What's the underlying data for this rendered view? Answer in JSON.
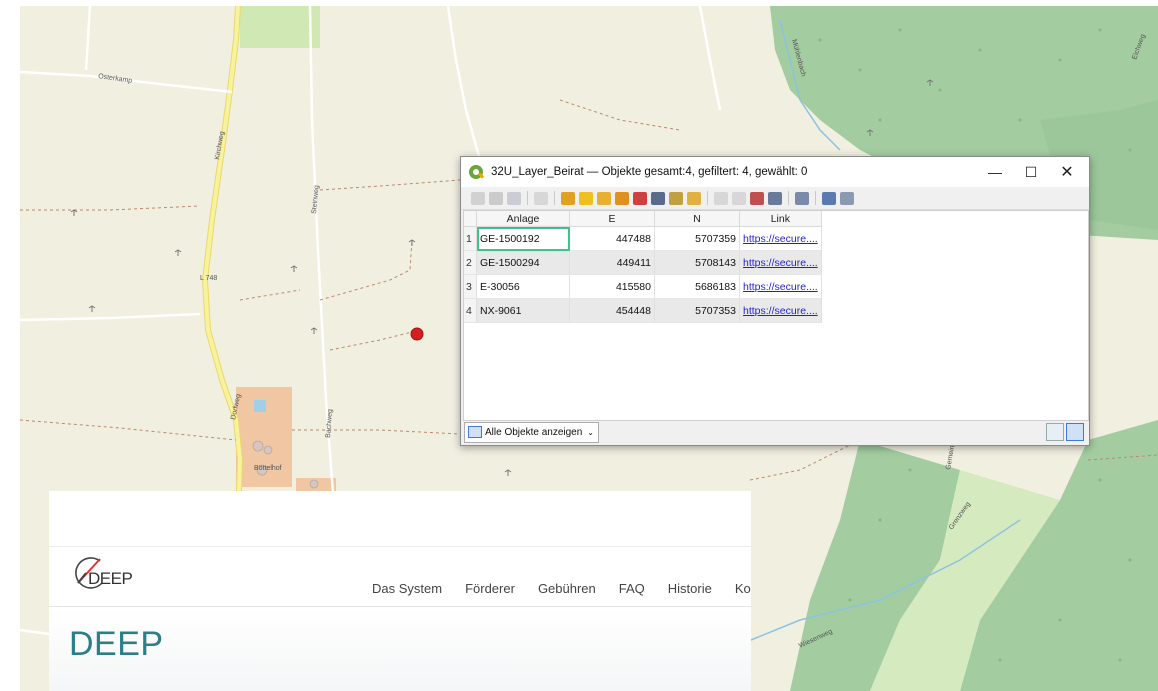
{
  "map": {
    "labels": {
      "road_l748": "L 748",
      "hof": "Böttelhof",
      "road_a": "Osterkamp",
      "road_b": "Kirchweg",
      "road_c": "Steinweg",
      "road_d": "Dorfweg",
      "road_e": "Bachweg",
      "road_f": "Eichweg",
      "road_g": "Mühlenbach",
      "road_h": "Gemeindegraben",
      "road_i": "Wiesenweg",
      "road_j": "Grenzweg"
    },
    "colors": {
      "base": "#f1efe0",
      "forest": "#9bc79a",
      "meadow": "#c8e3a5",
      "road_major": "#f7f2a0",
      "marker": "#d41f1f",
      "water": "#a8cfe3"
    }
  },
  "qgis": {
    "title": "32U_Layer_Beirat — Objekte gesamt:4, gefiltert: 4, gewählt: 0",
    "controls": {
      "minimize": "—",
      "maximize": "☐",
      "close": "✕"
    },
    "columns": [
      "Anlage",
      "E",
      "N",
      "Link"
    ],
    "rows": [
      {
        "n": "1",
        "anlage": "GE-1500192",
        "e": "447488",
        "nn": "5707359",
        "link": "https://secure...."
      },
      {
        "n": "2",
        "anlage": "GE-1500294",
        "e": "449411",
        "nn": "5708143",
        "link": "https://secure...."
      },
      {
        "n": "3",
        "anlage": "E-30056",
        "e": "415580",
        "nn": "5686183",
        "link": "https://secure...."
      },
      {
        "n": "4",
        "anlage": "NX-9061",
        "e": "454448",
        "nn": "5707353",
        "link": "https://secure...."
      }
    ],
    "show_all_label": "Alle Objekte anzeigen",
    "dropdown_glyph": "⌄"
  },
  "deep": {
    "logo_text": "DEEP",
    "nav": [
      "Das System",
      "Förderer",
      "Gebühren",
      "FAQ",
      "Historie",
      "Ko"
    ],
    "heading": "DEEP",
    "accent": "#2d7f87"
  }
}
